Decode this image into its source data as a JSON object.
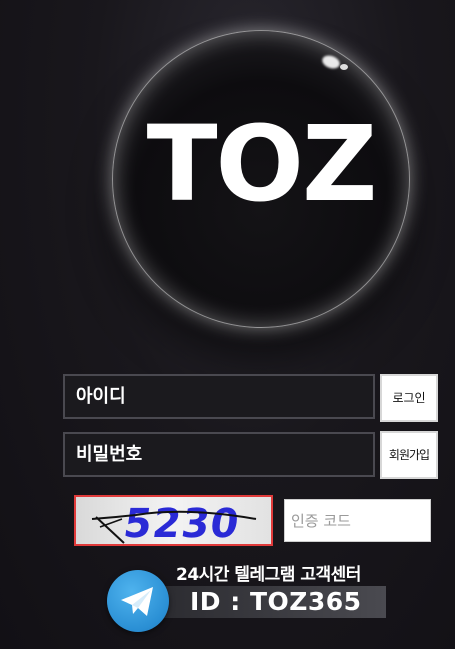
{
  "logo": {
    "text": "TOZ"
  },
  "login_form": {
    "id_placeholder": "아이디",
    "password_placeholder": "비밀번호",
    "login_button": "로그인",
    "signup_button": "회원가입",
    "captcha_value": "5230",
    "code_placeholder": "인증 코드"
  },
  "telegram": {
    "caption": "24시간 텔레그램 고객센터",
    "id_text": "ID : TOZ365",
    "icon": "telegram-icon"
  },
  "colors": {
    "background": "#19171c",
    "captcha_border": "#e03a3a",
    "captcha_text": "#2a2ad6",
    "telegram_blue": "#2a8fd4"
  }
}
